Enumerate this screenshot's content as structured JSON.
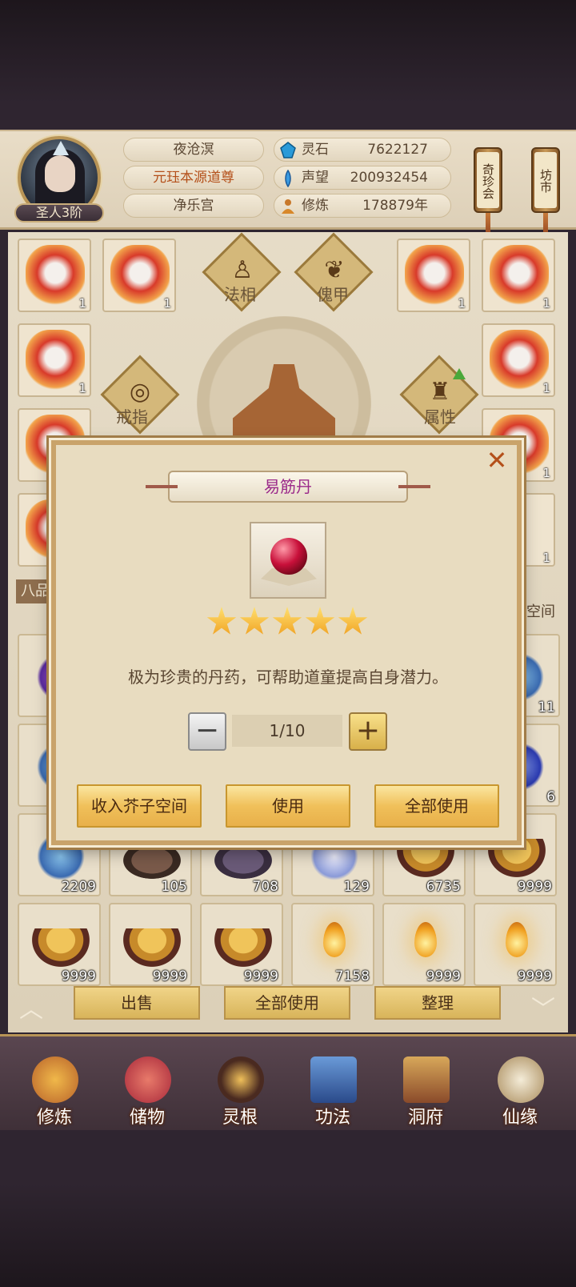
{
  "player": {
    "rank": "圣人3阶",
    "name": "夜沧溟",
    "title": "元珏本源道尊",
    "sect": "净乐宫"
  },
  "stats": [
    {
      "icon": "spirit-stone-icon",
      "label": "灵石",
      "value": "7622127"
    },
    {
      "icon": "prestige-icon",
      "label": "声望",
      "value": "200932454"
    },
    {
      "icon": "cultivation-icon",
      "label": "修炼",
      "value": "178879年"
    }
  ],
  "shortcuts": {
    "treasure_fair": "奇珍会",
    "market": "坊市"
  },
  "equip_slots": {
    "dharma": "法相",
    "puppet_armor": "傀甲",
    "ring": "戒指",
    "attribute": "属性"
  },
  "side_items": {
    "count_1": "1"
  },
  "inventory": {
    "grade_label": "八品",
    "space_label": "子空间",
    "visible_counts_right": [
      "11",
      "6"
    ],
    "row1": [
      "2209",
      "105",
      "708",
      "129",
      "6735",
      "9999"
    ],
    "row2": [
      "9999",
      "9999",
      "9999",
      "7158",
      "9999",
      "9999"
    ]
  },
  "bottom_actions": {
    "sell": "出售",
    "use_all": "全部使用",
    "sort": "整理"
  },
  "nav": [
    {
      "label": "修炼",
      "icon": "meditation-icon"
    },
    {
      "label": "储物",
      "icon": "storage-bag-icon"
    },
    {
      "label": "灵根",
      "icon": "spirit-root-icon"
    },
    {
      "label": "功法",
      "icon": "technique-book-icon"
    },
    {
      "label": "洞府",
      "icon": "cave-residence-icon"
    },
    {
      "label": "仙缘",
      "icon": "immortal-fate-icon"
    }
  ],
  "dialog": {
    "item_name": "易筋丹",
    "stars": 5,
    "description": "极为珍贵的丹药，可帮助道童提高自身潜力。",
    "quantity": "1/10",
    "minus": "−",
    "plus": "+",
    "close": "✕",
    "buttons": {
      "store": "收入芥子空间",
      "use": "使用",
      "use_all": "全部使用"
    }
  }
}
